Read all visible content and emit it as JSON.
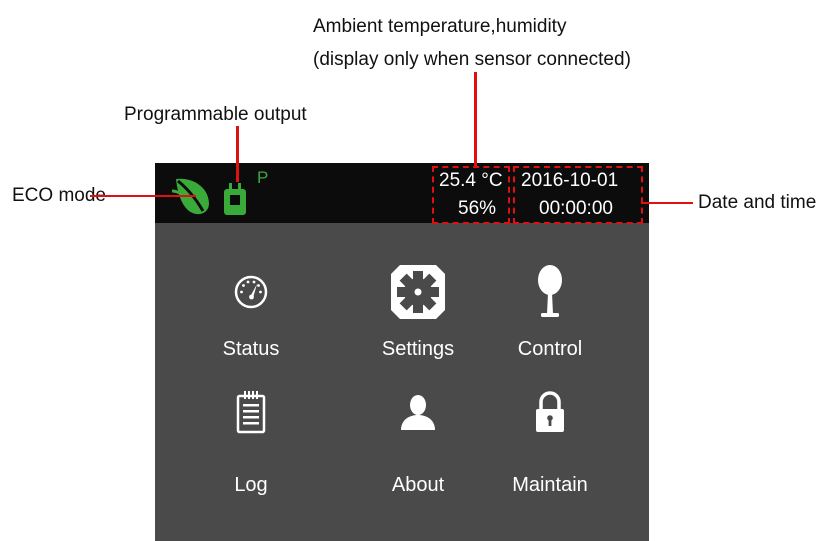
{
  "annotations": {
    "ambient": [
      "Ambient temperature,humidity",
      "(display only when sensor connected)"
    ],
    "programmable_output": "Programmable output",
    "eco_mode": "ECO mode",
    "date_time": "Date and time"
  },
  "screen": {
    "status_bar": {
      "output_badge": "P",
      "temperature": "25.4 °C",
      "humidity": "56%",
      "date": "2016-10-01",
      "time": "00:00:00"
    },
    "menu": [
      {
        "label": "Status",
        "icon": "gauge-icon"
      },
      {
        "label": "Settings",
        "icon": "gear-icon"
      },
      {
        "label": "Control",
        "icon": "control-knob-icon"
      },
      {
        "label": "Log",
        "icon": "log-notepad-icon"
      },
      {
        "label": "About",
        "icon": "person-icon"
      },
      {
        "label": "Maintain",
        "icon": "padlock-icon"
      }
    ]
  },
  "colors": {
    "leader_lines": "#e01010",
    "eco_leaf": "#3aaa3a",
    "output_plug": "#3aaa3a",
    "status_bar_bg": "#0c0c0c",
    "screen_bg": "#4a4a4a"
  }
}
